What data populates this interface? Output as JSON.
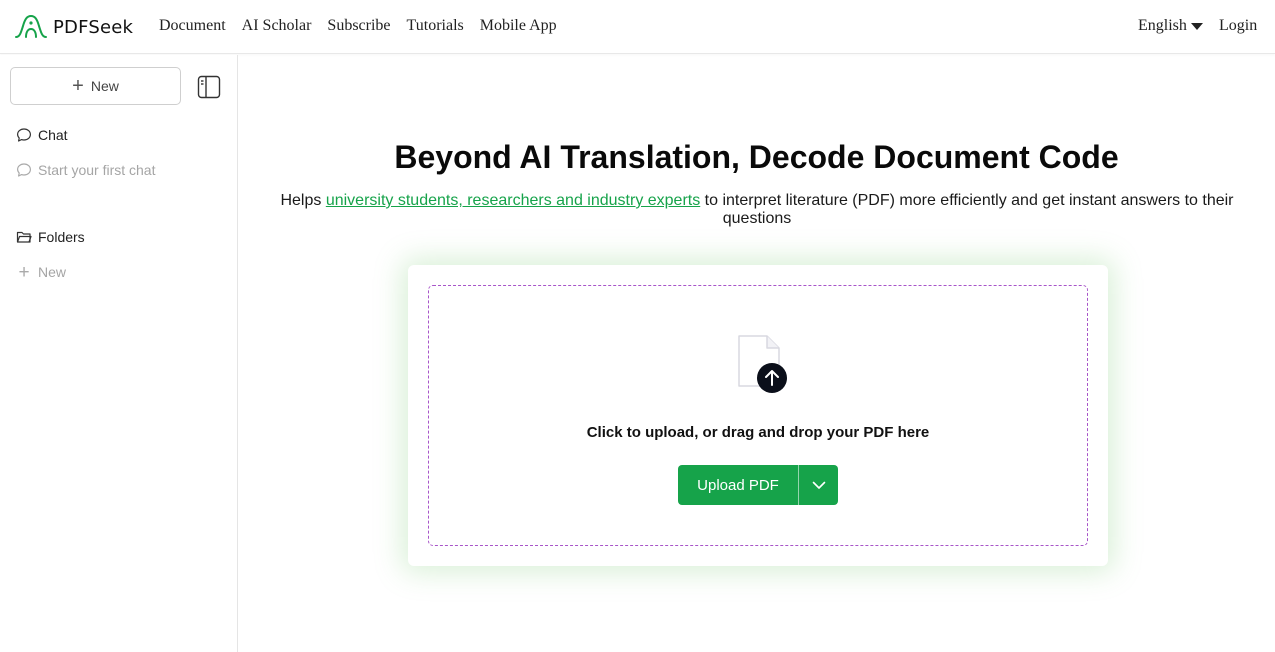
{
  "brand": {
    "name": "PDFSeek",
    "accent": "#16a34a"
  },
  "header": {
    "nav": [
      "Document",
      "AI Scholar",
      "Subscribe",
      "Tutorials",
      "Mobile App"
    ],
    "language": "English",
    "login": "Login"
  },
  "sidebar": {
    "new_button": "New",
    "chat_heading": "Chat",
    "chat_empty": "Start your first chat",
    "folders_heading": "Folders",
    "folders_new": "New"
  },
  "hero": {
    "title": "Beyond AI Translation, Decode Document Code",
    "sub_prefix": "Helps ",
    "sub_link": "university students, researchers and industry experts",
    "sub_suffix": " to interpret literature (PDF) more efficiently and get instant answers to their questions"
  },
  "upload": {
    "drop_text": "Click to upload, or drag and drop your PDF here",
    "button_label": "Upload PDF"
  },
  "icons": [
    "logo-icon",
    "plus-icon",
    "sidebar-toggle-icon",
    "chat-bubble-icon",
    "folder-icon",
    "file-upload-icon",
    "chevron-down-icon",
    "caret-down-icon"
  ]
}
